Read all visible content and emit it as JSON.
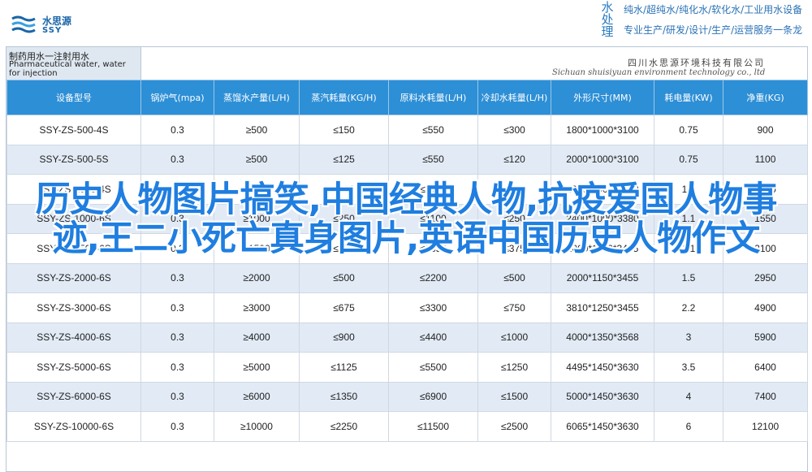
{
  "brand": {
    "logo_cn": "水思源",
    "logo_en": "SSY",
    "vertical_text": "水处理",
    "line1": "纯水/超纯水/纯化水/软化水/工业用水设备",
    "line2": "专业生产/研发/设计/生产/运营服务一条龙"
  },
  "sheet": {
    "title_cn": "制药用水一注射用水",
    "title_en": "Pharmaceutical water, water for injection",
    "company_cn": "四川水思源环境科技有限公司",
    "company_en": "Sichuan shuisiyuan environment technology co., ltd",
    "headers": [
      "设备型号",
      "锅炉气(mpa)",
      "蒸馏水产量(L/H)",
      "蒸汽耗量(KG/H)",
      "原料水耗量(L/H)",
      "冷却水耗量(L/H)",
      "外形尺寸(MM)",
      "耗电量(KW)",
      "净重(KG)"
    ],
    "rows": [
      [
        "SSY-ZS-500-4S",
        "0.3",
        "≥500",
        "≤150",
        "≤550",
        "≤300",
        "1800*1000*3100",
        "0.75",
        "900"
      ],
      [
        "SSY-ZS-500-5S",
        "0.3",
        "≥500",
        "≤125",
        "≤550",
        "≤120",
        "2000*1000*3100",
        "0.75",
        "1100"
      ],
      [
        "SSY-ZS-1000-4S",
        "0.3",
        "≥1000",
        "≤300",
        "≤1100",
        "≤600",
        "2200*1000*3380",
        "1.1",
        "1250"
      ],
      [
        "SSY-ZS-1000-6S",
        "0.3",
        "≥1000",
        "≤250",
        "≤1100",
        "≤250",
        "2400*1000*3380",
        "1.1",
        "1550"
      ],
      [
        "SSY-ZS-1500-6S",
        "0.3",
        "≥1500",
        "≤375",
        "≤1650",
        "≤375",
        "2000*1100*3455",
        "1.1",
        "2100"
      ],
      [
        "SSY-ZS-2000-6S",
        "0.3",
        "≥2000",
        "≤500",
        "≤2200",
        "≤500",
        "2000*1150*3455",
        "1.5",
        "2950"
      ],
      [
        "SSY-ZS-3000-6S",
        "0.3",
        "≥3000",
        "≤675",
        "≤3300",
        "≤750",
        "3810*1250*3455",
        "2.2",
        "4900"
      ],
      [
        "SSY-ZS-4000-6S",
        "0.3",
        "≥4000",
        "≤900",
        "≤4400",
        "≤1000",
        "4000*1350*3568",
        "3",
        "5900"
      ],
      [
        "SSY-ZS-5000-6S",
        "0.3",
        "≥5000",
        "≤1125",
        "≤5500",
        "≤1250",
        "4495*1450*3630",
        "3.5",
        "6400"
      ],
      [
        "SSY-ZS-6000-6S",
        "0.3",
        "≥6000",
        "≤1350",
        "≤6900",
        "≤1500",
        "5000*1450*3630",
        "4",
        "7400"
      ],
      [
        "SSY-ZS-10000-6S",
        "0.3",
        "≥10000",
        "≤2250",
        "≤11500",
        "≤2500",
        "6065*1450*3630",
        "6",
        "12100"
      ]
    ]
  },
  "overlay_text": "历史人物图片搞笑,中国经典人物,抗疫爱国人物事迹,王二小死亡真身图片,英语中国历史人物作文"
}
